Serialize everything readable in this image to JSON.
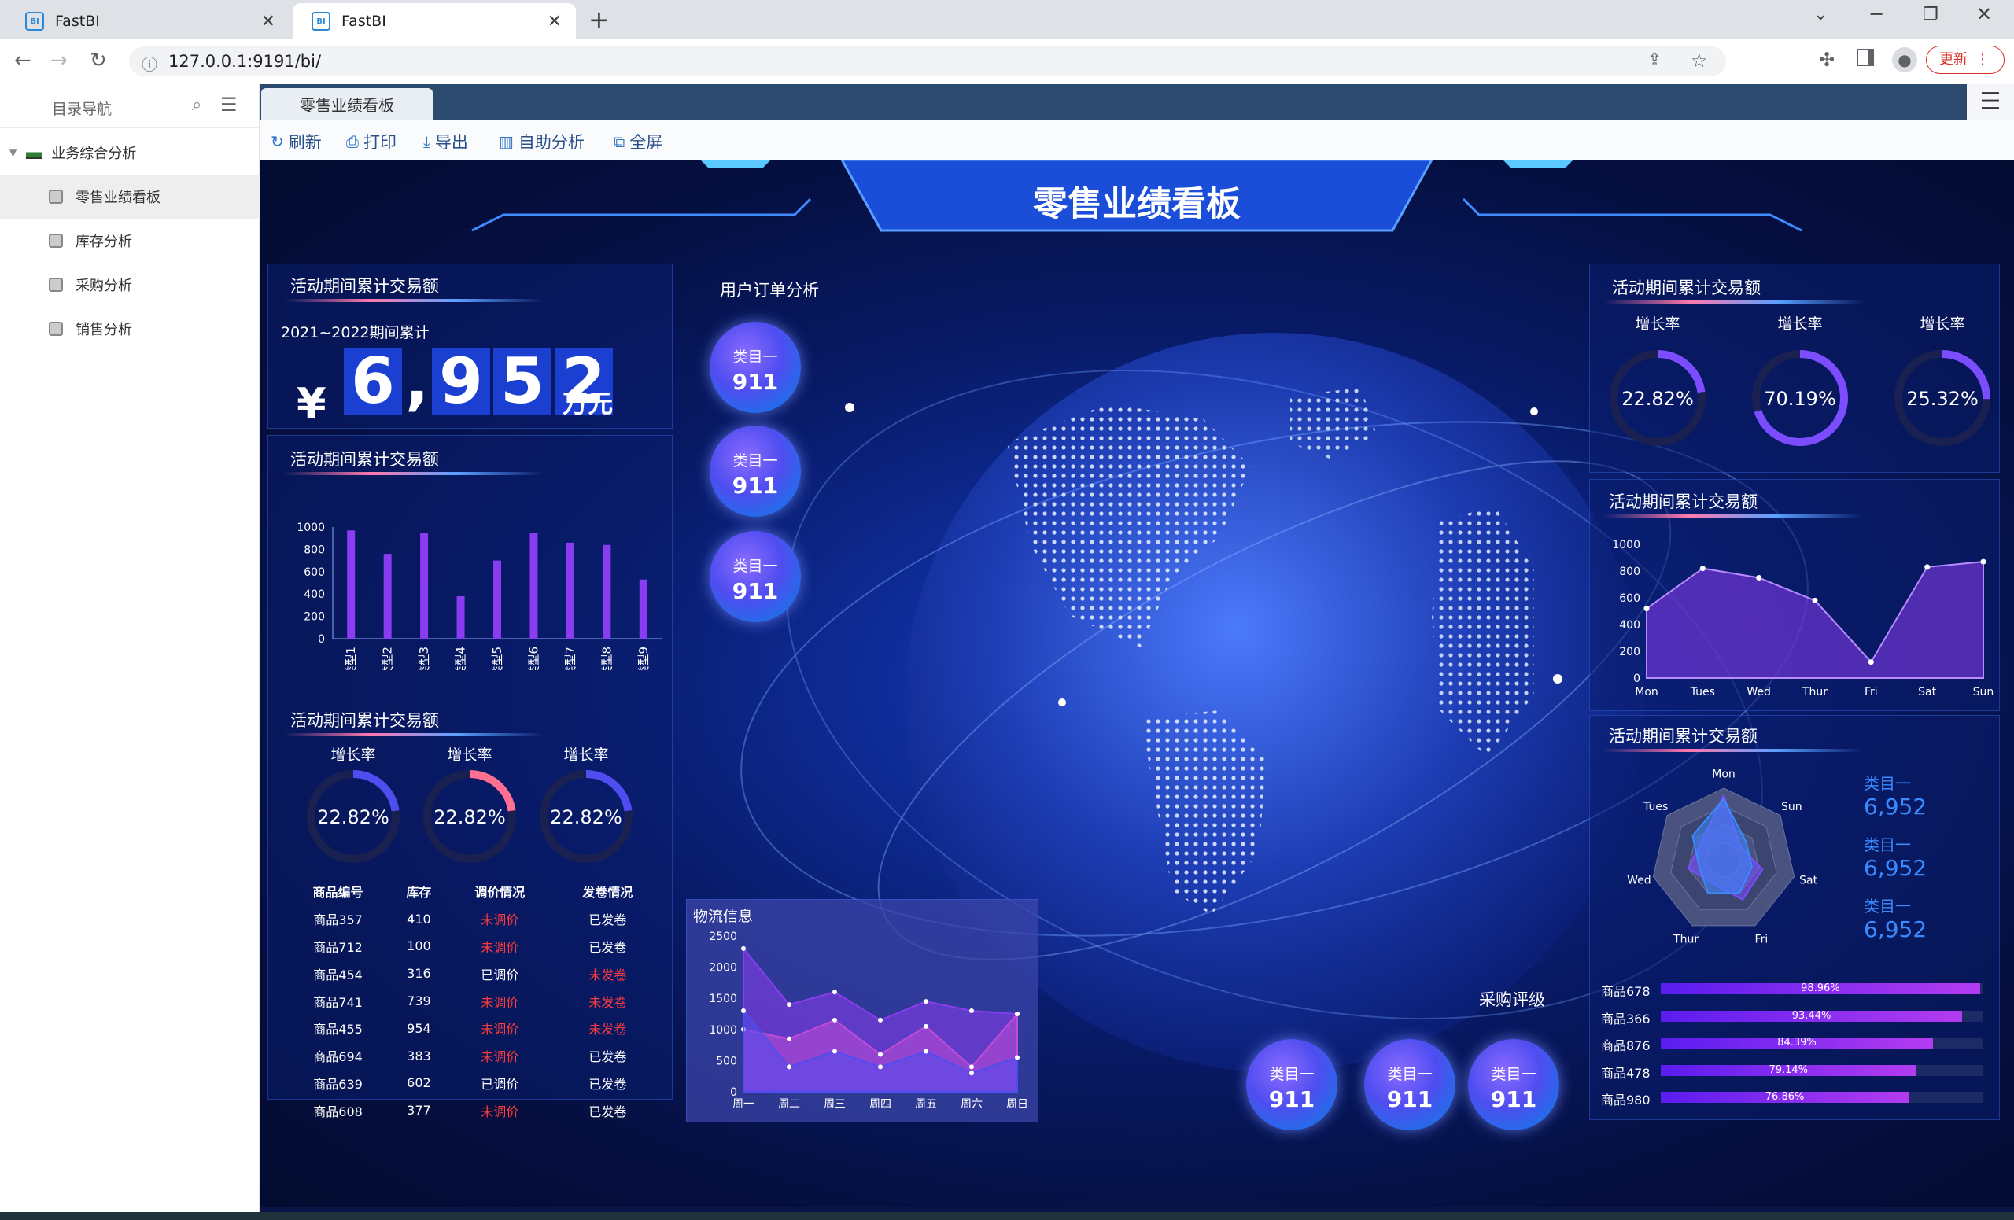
{
  "browser": {
    "tabs": [
      {
        "title": "FastBI",
        "favicon": "fastbi-favicon"
      },
      {
        "title": "FastBI",
        "favicon": "fastbi-favicon"
      }
    ],
    "new_tab_label": "+",
    "url": "127.0.0.1:9191/bi/",
    "update_button": "更新"
  },
  "sidebar": {
    "title": "目录导航",
    "root": "业务综合分析",
    "items": [
      {
        "label": "零售业绩看板",
        "selected": true
      },
      {
        "label": "库存分析",
        "selected": false
      },
      {
        "label": "采购分析",
        "selected": false
      },
      {
        "label": "销售分析",
        "selected": false
      }
    ]
  },
  "main": {
    "active_tab": "零售业绩看板",
    "toolbar": [
      {
        "label": "刷新",
        "icon": "refresh-icon"
      },
      {
        "label": "打印",
        "icon": "print-icon"
      },
      {
        "label": "导出",
        "icon": "download-icon"
      },
      {
        "label": "自助分析",
        "icon": "bar-chart-icon"
      },
      {
        "label": "全屏",
        "icon": "external-icon"
      }
    ]
  },
  "dashboard": {
    "title": "零售业绩看板",
    "total": {
      "title": "活动期间累计交易额",
      "period": "2021~2022期间累计",
      "currency": "¥",
      "digits": [
        "6",
        ",",
        "9",
        "5",
        "2"
      ],
      "unit": "万元"
    },
    "bar_panel_title": "活动期间累计交易额",
    "rings_left": {
      "title": "活动期间累计交易额",
      "items": [
        {
          "label": "增长率",
          "value": "22.82%",
          "fraction": 0.2282,
          "color": "#4f4df0"
        },
        {
          "label": "增长率",
          "value": "22.82%",
          "fraction": 0.2282,
          "color": "#ff6f91"
        },
        {
          "label": "增长率",
          "value": "22.82%",
          "fraction": 0.2282,
          "color": "#4f4df0"
        }
      ]
    },
    "table": {
      "headers": [
        "商品编号",
        "库存",
        "调价情况",
        "发卷情况"
      ],
      "rows": [
        [
          "商品357",
          "410",
          "未调价",
          "已发卷"
        ],
        [
          "商品712",
          "100",
          "未调价",
          "已发卷"
        ],
        [
          "商品454",
          "316",
          "已调价",
          "未发卷"
        ],
        [
          "商品741",
          "739",
          "未调价",
          "未发卷"
        ],
        [
          "商品455",
          "954",
          "未调价",
          "未发卷"
        ],
        [
          "商品694",
          "383",
          "未调价",
          "已发卷"
        ],
        [
          "商品639",
          "602",
          "已调价",
          "已发卷"
        ],
        [
          "商品608",
          "377",
          "未调价",
          "已发卷"
        ]
      ],
      "highlight_values": [
        "未调价",
        "未发卷"
      ],
      "highlight_color": "#ff3b3b"
    },
    "order_analysis": {
      "title": "用户订单分析",
      "bubbles": [
        {
          "label": "类目一",
          "value": "911"
        },
        {
          "label": "类目一",
          "value": "911"
        },
        {
          "label": "类目一",
          "value": "911"
        }
      ]
    },
    "logistics_title": "物流信息",
    "rating": {
      "title": "采购评级",
      "bubbles": [
        {
          "label": "类目一",
          "value": "911"
        },
        {
          "label": "类目一",
          "value": "911"
        },
        {
          "label": "类目一",
          "value": "911"
        }
      ]
    },
    "rings_right": {
      "title": "活动期间累计交易额",
      "items": [
        {
          "label": "增长率",
          "value": "22.82%",
          "fraction": 0.2282,
          "color": "#7b4dff"
        },
        {
          "label": "增长率",
          "value": "70.19%",
          "fraction": 0.7019,
          "color": "#7b4dff"
        },
        {
          "label": "增长率",
          "value": "25.32%",
          "fraction": 0.2532,
          "color": "#7b4dff"
        }
      ]
    },
    "area_panel_title": "活动期间累计交易额",
    "radar_panel": {
      "title": "活动期间累计交易额",
      "stats": [
        {
          "label": "类目一",
          "value": "6,952"
        },
        {
          "label": "类目一",
          "value": "6,952"
        },
        {
          "label": "类目一",
          "value": "6,952"
        }
      ]
    },
    "progress": [
      {
        "name": "商品678",
        "label": "98.96%",
        "value": 0.9896
      },
      {
        "name": "商品366",
        "label": "93.44%",
        "value": 0.9344
      },
      {
        "name": "商品876",
        "label": "84.39%",
        "value": 0.8439
      },
      {
        "name": "商品478",
        "label": "79.14%",
        "value": 0.7914
      },
      {
        "name": "商品980",
        "label": "76.86%",
        "value": 0.7686
      }
    ]
  },
  "chart_data": [
    {
      "type": "bar",
      "categories": [
        "类型1",
        "类型2",
        "类型3",
        "类型4",
        "类型5",
        "类型6",
        "类型7",
        "类型8",
        "类型9"
      ],
      "values": [
        970,
        760,
        950,
        380,
        700,
        950,
        860,
        840,
        530
      ],
      "ylim": [
        0,
        1000
      ],
      "yticks": [
        0,
        200,
        400,
        600,
        800,
        1000
      ],
      "color": "#8a3cf0"
    },
    {
      "type": "area",
      "categories": [
        "周一",
        "周二",
        "周三",
        "周四",
        "周五",
        "周六",
        "周日"
      ],
      "ylim": [
        0,
        2500
      ],
      "yticks": [
        0,
        500,
        1000,
        1500,
        2000,
        2500
      ],
      "series": [
        {
          "values": [
            2300,
            1400,
            1600,
            1150,
            1450,
            1300,
            1250
          ],
          "color": "#8a3cf0"
        },
        {
          "values": [
            1000,
            850,
            1150,
            600,
            1050,
            400,
            1250
          ],
          "color": "#c04dd6"
        },
        {
          "values": [
            1300,
            400,
            650,
            400,
            650,
            300,
            550
          ],
          "color": "#4f4df0"
        }
      ]
    },
    {
      "type": "area",
      "categories": [
        "Mon",
        "Tues",
        "Wed",
        "Thur",
        "Fri",
        "Sat",
        "Sun"
      ],
      "values": [
        520,
        820,
        750,
        580,
        120,
        830,
        870
      ],
      "ylim": [
        0,
        1000
      ],
      "yticks": [
        0,
        200,
        400,
        600,
        800,
        1000
      ],
      "color": "#8a3cf0"
    },
    {
      "type": "radar",
      "categories": [
        "Mon",
        "Sun",
        "Sat",
        "Fri",
        "Thur",
        "Wed",
        "Tues"
      ],
      "series": [
        {
          "values": [
            0.9,
            0.3,
            0.55,
            0.6,
            0.35,
            0.5,
            0.4
          ],
          "color": "#7b4dff"
        },
        {
          "values": [
            0.85,
            0.4,
            0.4,
            0.5,
            0.5,
            0.35,
            0.55
          ],
          "color": "#3a8bff"
        }
      ]
    }
  ]
}
